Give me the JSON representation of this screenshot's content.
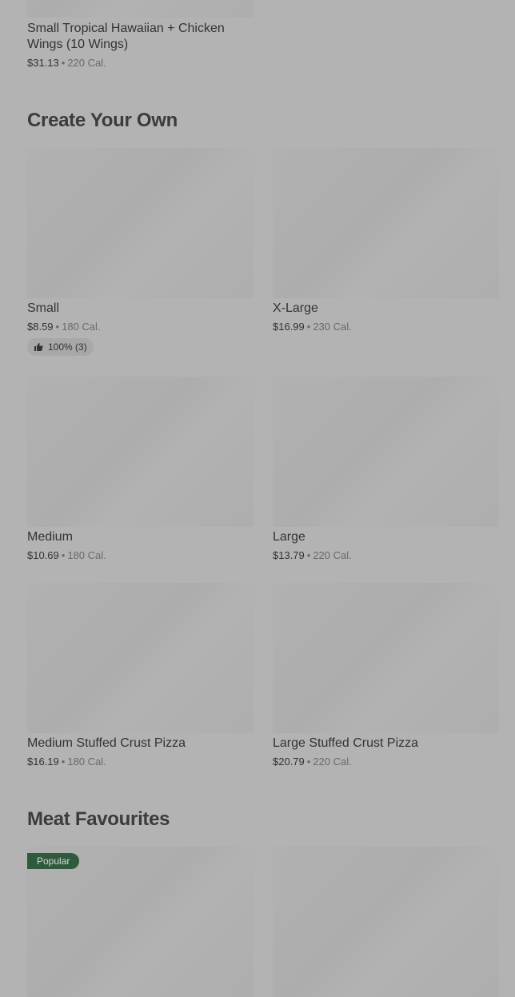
{
  "sections": {
    "prev_item": {
      "title": "Small Tropical Hawaiian + Chicken Wings (10 Wings)",
      "price": "$31.13",
      "calories": "220 Cal."
    },
    "create_your_own": {
      "heading": "Create Your Own",
      "items": [
        {
          "title": "Small",
          "price": "$8.59",
          "calories": "180 Cal.",
          "rating": "100% (3)"
        },
        {
          "title": "X-Large",
          "price": "$16.99",
          "calories": "230 Cal."
        },
        {
          "title": "Medium",
          "price": "$10.69",
          "calories": "180 Cal."
        },
        {
          "title": "Large",
          "price": "$13.79",
          "calories": "220 Cal."
        },
        {
          "title": "Medium Stuffed Crust Pizza",
          "price": "$16.19",
          "calories": "180 Cal."
        },
        {
          "title": "Large Stuffed Crust Pizza",
          "price": "$20.79",
          "calories": "220 Cal."
        }
      ]
    },
    "meat_favourites": {
      "heading": "Meat Favourites",
      "badge": "Popular"
    }
  },
  "separator": "•",
  "icons": {
    "thumbs_up": "thumbs-up-icon"
  }
}
